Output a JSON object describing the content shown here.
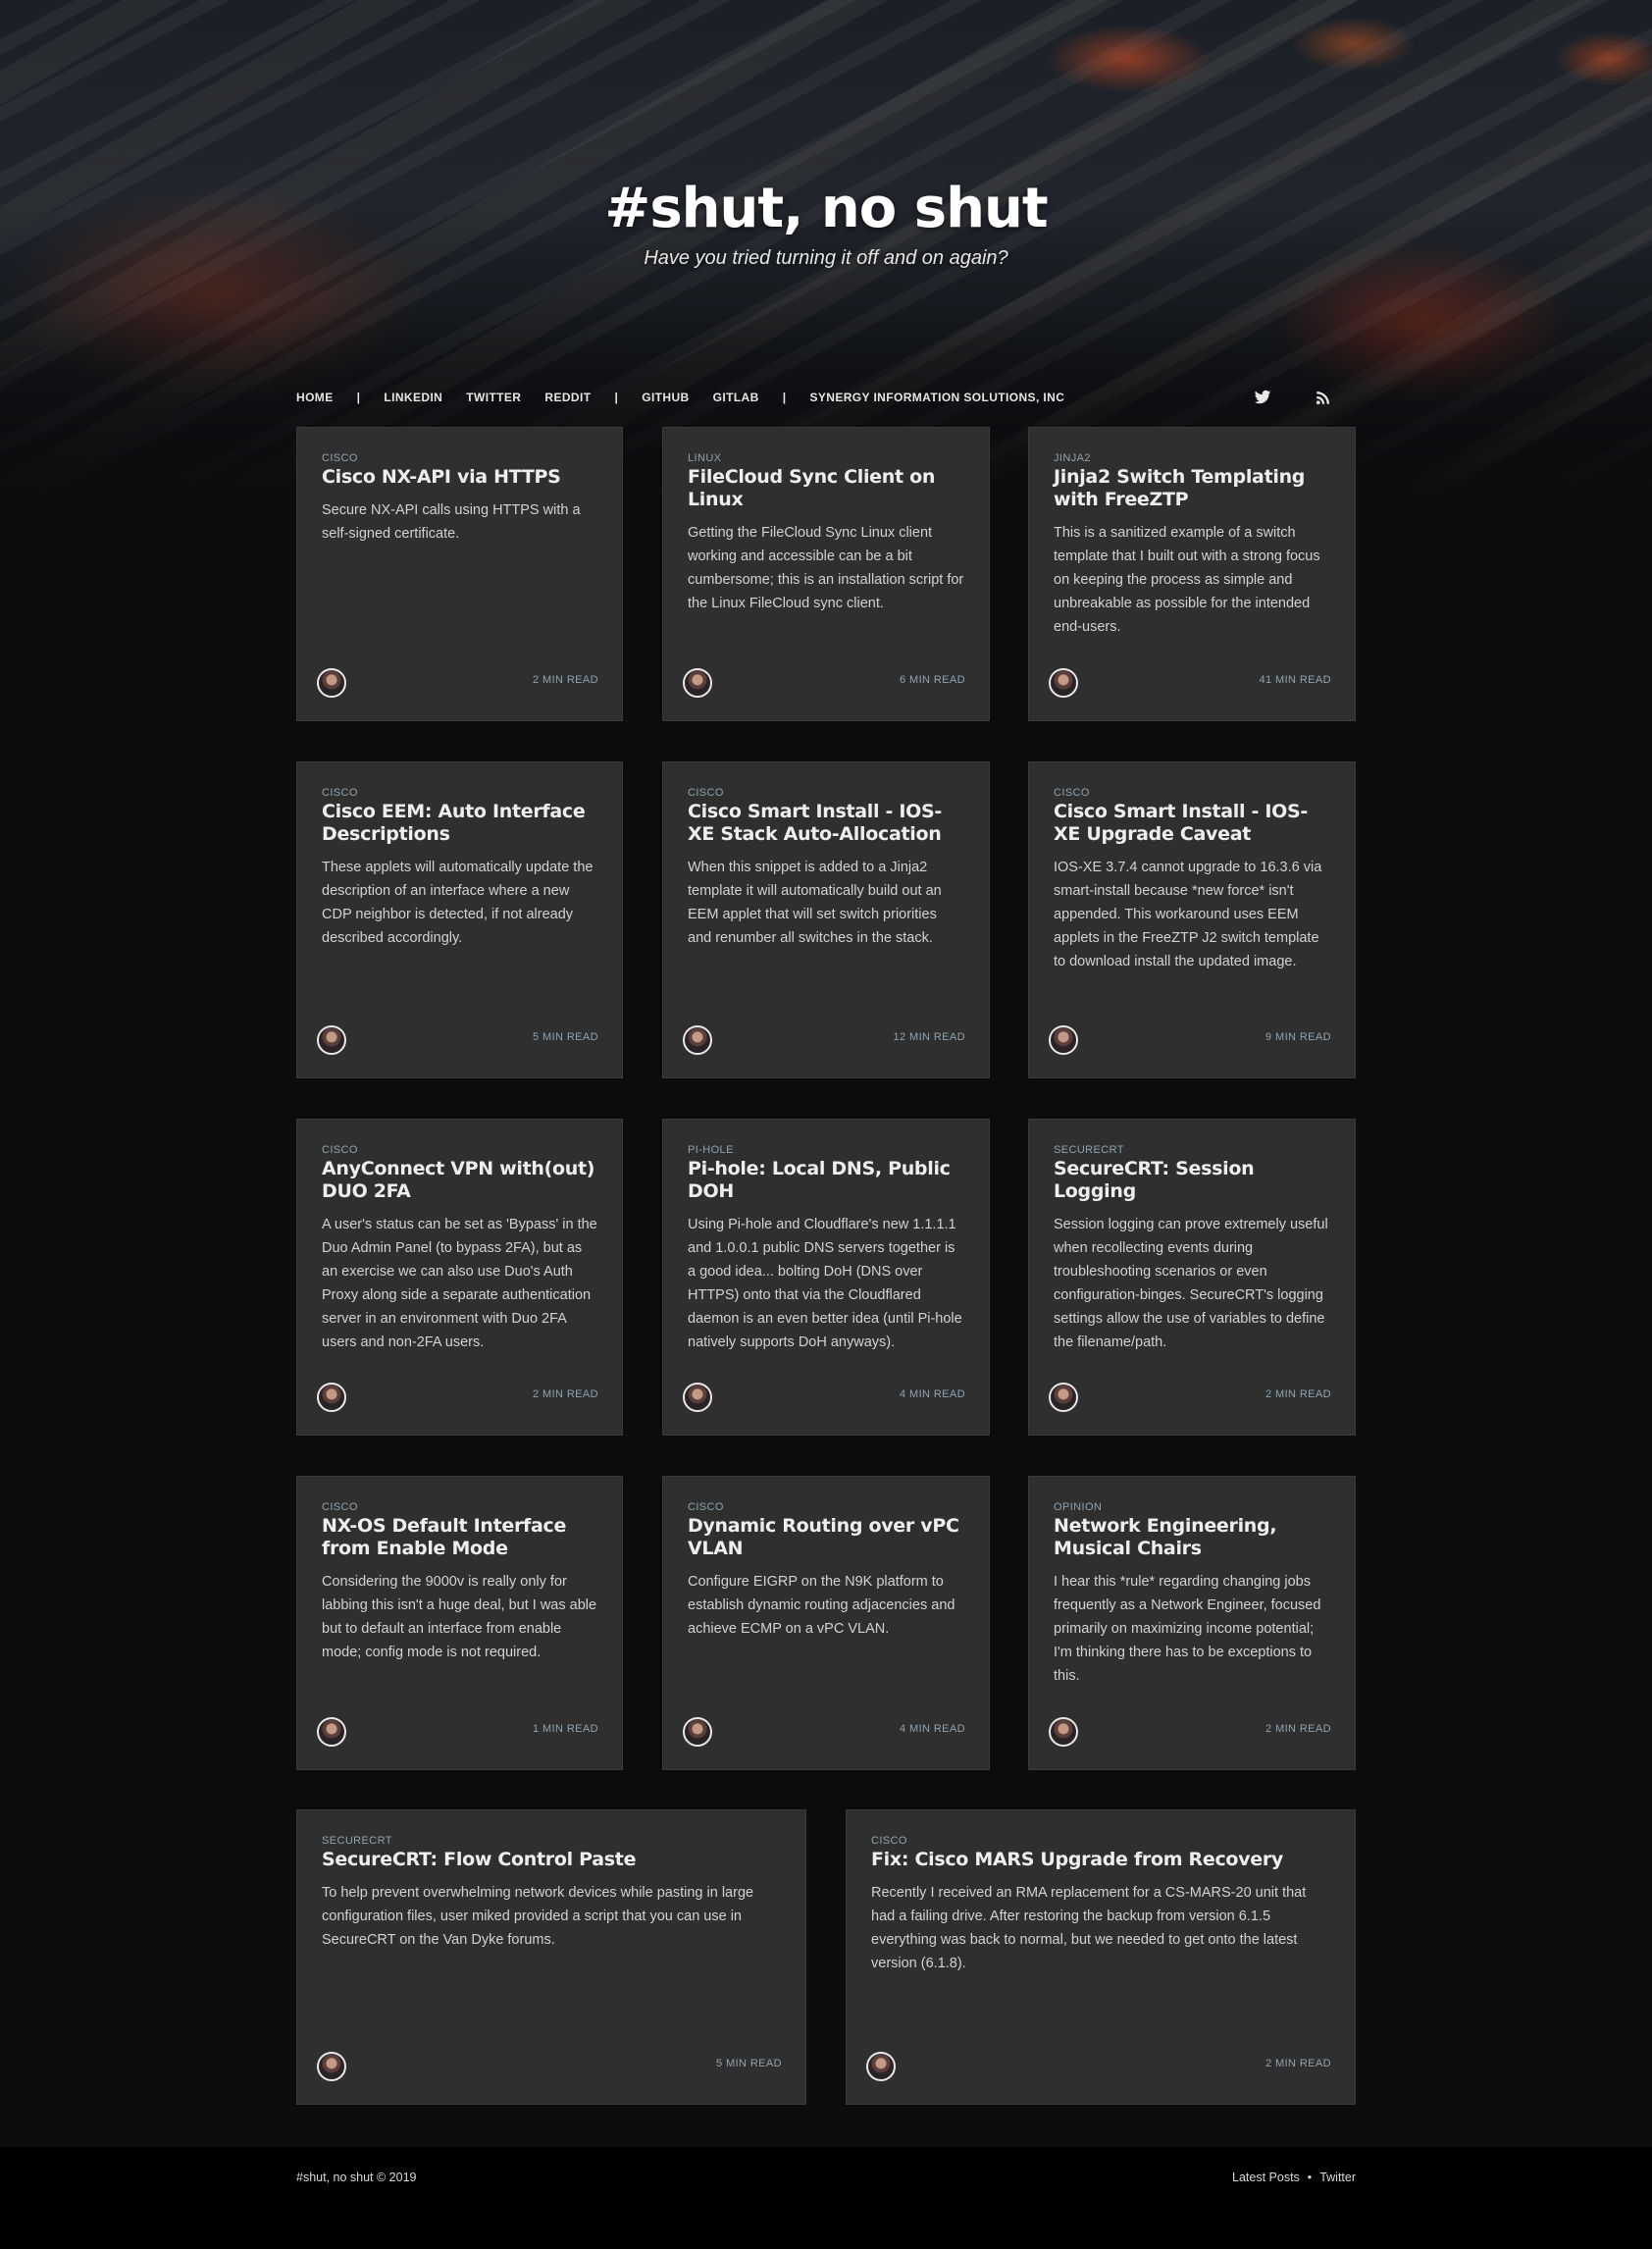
{
  "site": {
    "title": "#shut, no shut",
    "description": "Have you tried turning it off and on again?"
  },
  "nav": {
    "items": [
      {
        "label": "Home"
      },
      {
        "label": "|"
      },
      {
        "label": "LinkedIn"
      },
      {
        "label": "Twitter"
      },
      {
        "label": "Reddit"
      },
      {
        "label": "|"
      },
      {
        "label": "GitHub"
      },
      {
        "label": "GitLab"
      },
      {
        "label": "|"
      },
      {
        "label": "Synergy Information Solutions, Inc"
      }
    ],
    "icons": [
      "twitter-icon",
      "rss-icon"
    ]
  },
  "posts": [
    {
      "tag": "Cisco",
      "title": "Cisco NX-API via HTTPS",
      "excerpt": "Secure NX-API calls using HTTPS with a self-signed certificate.",
      "read": "2 min read"
    },
    {
      "tag": "Linux",
      "title": "FileCloud Sync Client on Linux",
      "excerpt": "Getting the FileCloud Sync Linux client working and accessible can be a bit cumbersome; this is an installation script for the Linux FileCloud sync client.",
      "read": "6 min read"
    },
    {
      "tag": "Jinja2",
      "title": "Jinja2 Switch Templating with FreeZTP",
      "excerpt": "This is a sanitized example of a switch template that I built out with a strong focus on keeping the process as simple and unbreakable as possible for the intended end-users.",
      "read": "41 min read"
    },
    {
      "tag": "Cisco",
      "title": "Cisco EEM: Auto Interface Descriptions",
      "excerpt": "These applets will automatically update the description of an interface where a new CDP neighbor is detected, if not already described accordingly.",
      "read": "5 min read"
    },
    {
      "tag": "Cisco",
      "title": "Cisco Smart Install - IOS-XE Stack Auto-Allocation",
      "excerpt": "When this snippet is added to a Jinja2 template it will automatically build out an EEM applet that will set switch priorities and renumber all switches in the stack.",
      "read": "12 min read"
    },
    {
      "tag": "Cisco",
      "title": "Cisco Smart Install - IOS-XE Upgrade Caveat",
      "excerpt": "IOS-XE 3.7.4 cannot upgrade to 16.3.6 via smart-install because *new force* isn't appended. This workaround uses EEM applets in the FreeZTP J2 switch template to download install the updated image.",
      "read": "9 min read"
    },
    {
      "tag": "Cisco",
      "title": "AnyConnect VPN with(out) DUO 2FA",
      "excerpt": "A user's status can be set as 'Bypass' in the Duo Admin Panel (to bypass 2FA), but as an exercise we can also use Duo's Auth Proxy along side a separate authentication server in an environment with Duo 2FA users and non-2FA users.",
      "read": "2 min read"
    },
    {
      "tag": "Pi-hole",
      "title": "Pi-hole: Local DNS, Public DOH",
      "excerpt": "Using Pi-hole and Cloudflare's new 1.1.1.1 and 1.0.0.1 public DNS servers together is a good idea... bolting DoH (DNS over HTTPS) onto that via the Cloudflared daemon is an even better idea (until Pi-hole natively supports DoH anyways).",
      "read": "4 min read"
    },
    {
      "tag": "SecureCRT",
      "title": "SecureCRT: Session Logging",
      "excerpt": "Session logging can prove extremely useful when recollecting events during troubleshooting scenarios or even configuration-binges. SecureCRT's logging settings allow the use of variables to define the filename/path.",
      "read": "2 min read"
    },
    {
      "tag": "Cisco",
      "title": "NX-OS Default Interface from Enable Mode",
      "excerpt": "Considering the 9000v is really only for labbing this isn't a huge deal, but I was able but to default an interface from enable mode; config mode is not required.",
      "read": "1 min read"
    },
    {
      "tag": "Cisco",
      "title": "Dynamic Routing over vPC VLAN",
      "excerpt": "Configure EIGRP on the N9K platform to establish dynamic routing adjacencies and achieve ECMP on a vPC VLAN.",
      "read": "4 min read"
    },
    {
      "tag": "Opinion",
      "title": "Network Engineering, Musical Chairs",
      "excerpt": "I hear this *rule* regarding changing jobs frequently as a Network Engineer, focused primarily on maximizing income potential; I'm thinking there has to be exceptions to this.",
      "read": "2 min read"
    },
    {
      "tag": "SecureCRT",
      "title": "SecureCRT: Flow Control Paste",
      "excerpt": "To help prevent overwhelming network devices while pasting in large configuration files, user miked provided a script that you can use in SecureCRT on the Van Dyke forums.",
      "read": "5 min read"
    },
    {
      "tag": "Cisco",
      "title": "Fix: Cisco MARS Upgrade from Recovery",
      "excerpt": "Recently I received an RMA replacement for a CS-MARS-20 unit that had a failing drive. After restoring the backup from version 6.1.5 everything was back to normal, but we needed to get onto the latest version (6.1.8).",
      "read": "2 min read"
    }
  ],
  "footer": {
    "copyright": "#shut, no shut © 2019",
    "links": [
      {
        "label": "Latest Posts"
      },
      {
        "label": "•"
      },
      {
        "label": "Twitter"
      }
    ]
  }
}
